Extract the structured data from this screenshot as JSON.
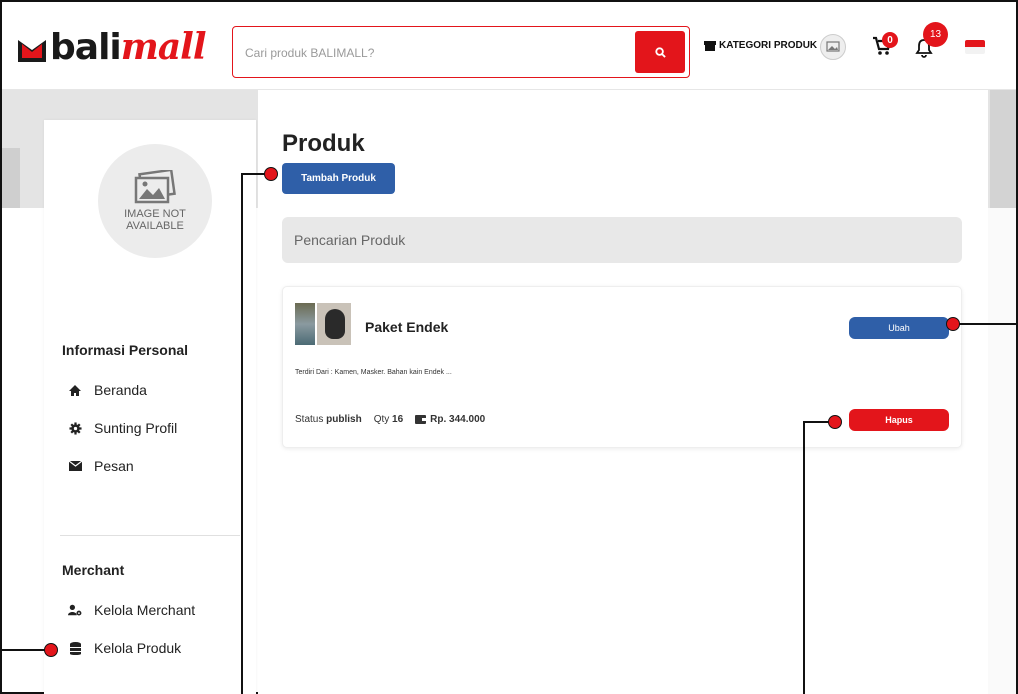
{
  "header": {
    "logo": {
      "prefix": "bali",
      "suffix": "mall"
    },
    "search": {
      "placeholder": "Cari produk BALIMALL?"
    },
    "kategori_label": "KATEGORI PRODUK",
    "cart_count": "0",
    "notification_count": "13"
  },
  "sidebar": {
    "avatar_text": "IMAGE NOT AVAILABLE",
    "section_personal": "Informasi Personal",
    "personal_items": [
      {
        "label": "Beranda",
        "icon": "home-icon"
      },
      {
        "label": "Sunting Profil",
        "icon": "cog-icon"
      },
      {
        "label": "Pesan",
        "icon": "envelope-icon"
      }
    ],
    "section_merchant": "Merchant",
    "merchant_items": [
      {
        "label": "Kelola Merchant",
        "icon": "user-cog-icon"
      },
      {
        "label": "Kelola Produk",
        "icon": "database-icon"
      }
    ]
  },
  "main": {
    "title": "Produk",
    "add_button": "Tambah Produk",
    "search_placeholder": "Pencarian Produk",
    "products": [
      {
        "name": "Paket Endek",
        "description": "Terdiri Dari : Kamen, Masker. Bahan kain Endek ...",
        "status_label": "Status",
        "status_value": "publish",
        "qty_label": "Qty",
        "qty_value": "16",
        "price": "Rp. 344.000",
        "edit_button": "Ubah",
        "delete_button": "Hapus"
      }
    ]
  },
  "colors": {
    "brand_red": "#e3151b",
    "primary_blue": "#2f5fa8"
  }
}
